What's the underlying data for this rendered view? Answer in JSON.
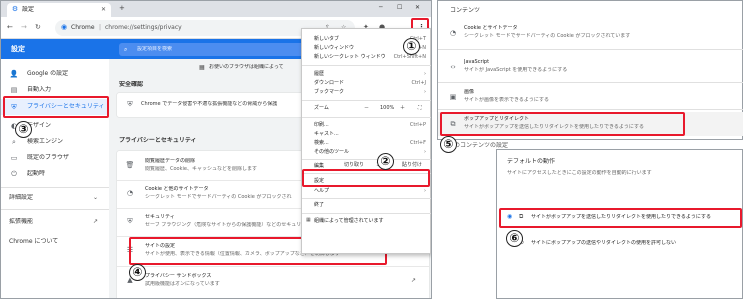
{
  "colors": {
    "accent": "#1a73e8",
    "highlight": "#e8192c",
    "sidebar_active": "#e8f0fe"
  },
  "browser": {
    "tab_title": "設定",
    "new_tab": "+",
    "url_prefix": "Chrome",
    "url": "chrome://settings/privacy",
    "more_menu_dots": "⋮"
  },
  "settings_header": {
    "title": "設定",
    "search_placeholder": "設定項目を検索"
  },
  "sidebar": {
    "items": [
      {
        "icon": "person-icon",
        "label": "Google の設定"
      },
      {
        "icon": "autofill-icon",
        "label": "自動入力"
      },
      {
        "icon": "shield-icon",
        "label": "プライバシーとセキュリティ"
      },
      {
        "icon": "palette-icon",
        "label": "デザイン"
      },
      {
        "icon": "search-icon",
        "label": "検索エンジン"
      },
      {
        "icon": "browser-icon",
        "label": "既定のブラウザ"
      },
      {
        "icon": "power-icon",
        "label": "起動時"
      }
    ],
    "advanced": "詳細設定",
    "extensions": "拡張機能",
    "about": "Chrome について"
  },
  "content": {
    "notice": "お使いのブラウザは組織によって",
    "safety_check_title": "安全確認",
    "safety_check_desc": "Chrome でデータ侵害や不適な拡張機能などの脅威から保護",
    "privacy_title": "プライバシーとセキュリティ",
    "rows": [
      {
        "title": "閲覧履歴データの削除",
        "desc": "閲覧履歴、Cookie、キャッシュなどを削除します"
      },
      {
        "title": "Cookie と他のサイトデータ",
        "desc": "シークレット モードでサードパーティの Cookie がブロックされ"
      },
      {
        "title": "セキュリティ",
        "desc": "セーフ ブラウジング（危険なサイトからの保護機能）などのセキュリティ設定"
      },
      {
        "title": "サイトの設定",
        "desc": "サイトが使用、表示できる情報（位置情報、カメラ、ポップアップなど）を制御します"
      },
      {
        "title": "プライバシー サンドボックス",
        "desc": "試用版機能はオンになっています"
      }
    ]
  },
  "menu": {
    "items": [
      {
        "label": "新しいタブ",
        "shortcut": "Ctrl+T"
      },
      {
        "label": "新しいウィンドウ",
        "shortcut": "Ctrl+N"
      },
      {
        "label": "新しいシークレット ウィンドウ",
        "shortcut": "Ctrl+Shift+N"
      },
      {
        "label": "履歴",
        "shortcut": ""
      },
      {
        "label": "ダウンロード",
        "shortcut": "Ctrl+J"
      },
      {
        "label": "ブックマーク",
        "shortcut": ""
      },
      {
        "label": "ズーム",
        "shortcut": ""
      },
      {
        "label": "印刷...",
        "shortcut": "Ctrl+P"
      },
      {
        "label": "キャスト...",
        "shortcut": ""
      },
      {
        "label": "検索...",
        "shortcut": "Ctrl+F"
      },
      {
        "label": "その他のツール",
        "shortcut": ""
      },
      {
        "label": "設定",
        "shortcut": ""
      },
      {
        "label": "ヘルプ",
        "shortcut": ""
      },
      {
        "label": "終了",
        "shortcut": ""
      }
    ],
    "zoom_minus": "－",
    "zoom_value": "100%",
    "zoom_plus": "＋",
    "edit_label": "編集",
    "cut": "切り取り",
    "copy": "コピー",
    "paste": "貼り付け",
    "managed": "組織によって管理されています"
  },
  "panel_a": {
    "section_title": "コンテンツ",
    "rows": [
      {
        "title": "Cookie とサイトデータ",
        "desc": "シークレット モードでサードパーティの Cookie がブロックされています"
      },
      {
        "title": "JavaScript",
        "desc": "サイトが JavaScript を使用できるようにする"
      },
      {
        "title": "画像",
        "desc": "サイトが画像を表示できるようにする"
      },
      {
        "title": "ポップアップとリダイレクト",
        "desc": "サイトがポップアップを送信したりリダイレクトを使用したりできるようにする"
      }
    ],
    "partial_label": "のコンテンツの設定"
  },
  "panel_b": {
    "default_title": "デフォルトの動作",
    "default_desc": "サイトにアクセスしたときにこの設定の動作を自動的に行います",
    "option_allow": "サイトがポップアップを送信したりリダイレクトを使用したりできるようにする",
    "option_block": "サイトにポップアップの送信やリダイレクトの使用を許可しない"
  },
  "callouts": [
    "①",
    "②",
    "③",
    "④",
    "⑤",
    "⑥"
  ]
}
